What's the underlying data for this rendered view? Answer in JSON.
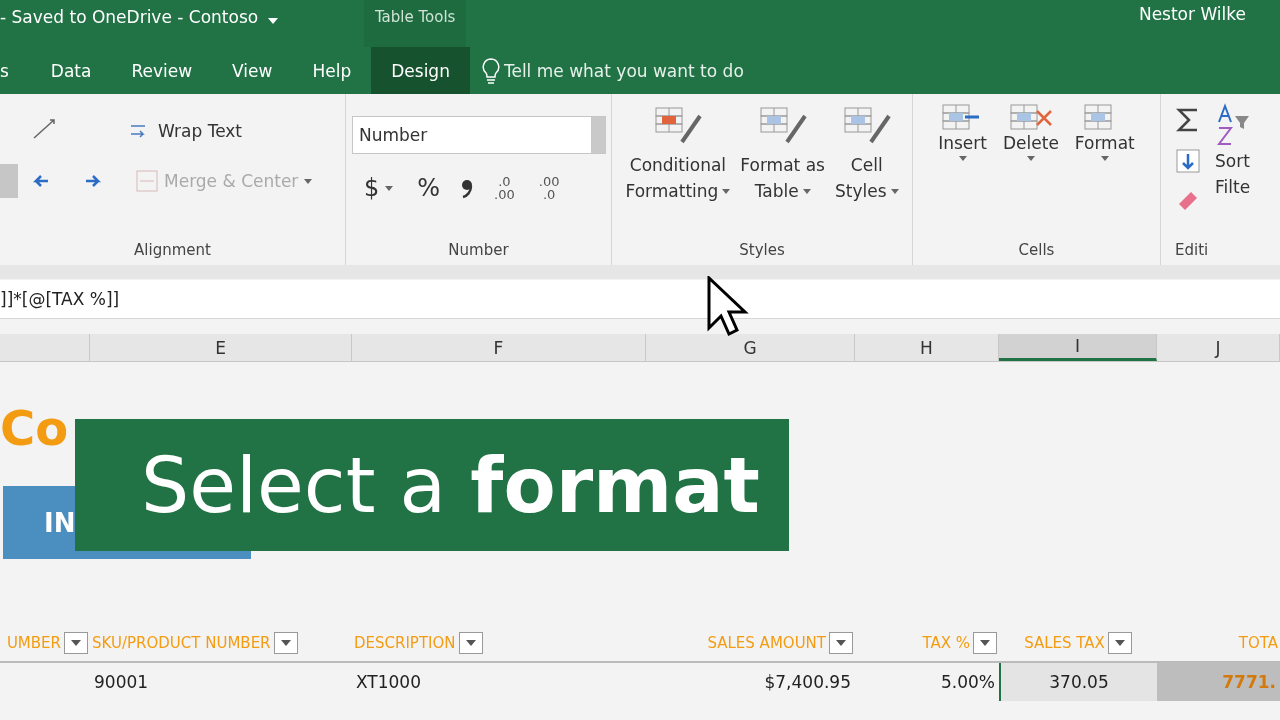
{
  "title_bar": {
    "title": "- Saved to OneDrive - Contoso",
    "context_label": "Table Tools",
    "user": "Nestor Wilke"
  },
  "tabs": [
    {
      "label": "s",
      "selected": false
    },
    {
      "label": "Data",
      "selected": false
    },
    {
      "label": "Review",
      "selected": false
    },
    {
      "label": "View",
      "selected": false
    },
    {
      "label": "Help",
      "selected": false
    },
    {
      "label": "Design",
      "selected": true
    }
  ],
  "tell_me": "Tell me what you want to do",
  "ribbon": {
    "alignment": {
      "wrap_text": "Wrap Text",
      "merge": "Merge & Center",
      "merge_disabled": true,
      "label": "Alignment"
    },
    "number": {
      "format": "Number",
      "currency": "$",
      "percent": "%",
      "decimals": [
        {
          "top": ".0",
          "bottom": ".00"
        },
        {
          "top": ".00",
          "bottom": ".0"
        }
      ],
      "label": "Number"
    },
    "styles": {
      "buttons": [
        {
          "line1": "Conditional",
          "line2": "Formatting"
        },
        {
          "line1": "Format as",
          "line2": "Table"
        },
        {
          "line1": "Cell",
          "line2": "Styles"
        }
      ],
      "label": "Styles"
    },
    "cells": {
      "buttons": [
        {
          "label": "Insert"
        },
        {
          "label": "Delete"
        },
        {
          "label": "Format"
        }
      ],
      "label": "Cells"
    },
    "editing": {
      "sort_line1": "Sort",
      "sort_line2": "Filte",
      "label": "Editi"
    }
  },
  "formula": "]]*[@[TAX %]]",
  "columns": [
    {
      "selected": false
    },
    {
      "label": "E",
      "selected": false
    },
    {
      "label": "F",
      "selected": false
    },
    {
      "label": "G",
      "selected": false
    },
    {
      "label": "H",
      "selected": false
    },
    {
      "label": "I",
      "selected": true
    },
    {
      "label": "J",
      "selected": false
    }
  ],
  "sheet": {
    "title": "Co",
    "banner": "IN"
  },
  "caption": "Select a **format**",
  "table": {
    "headers": [
      "UMBER",
      "SKU/PRODUCT NUMBER",
      "DESCRIPTION",
      "SALES AMOUNT",
      "TAX %",
      "SALES TAX",
      "TOTA"
    ],
    "rows": [
      [
        "",
        "90001",
        "XT1000",
        "$7,400.95",
        "5.00%",
        "370.05",
        "7771."
      ]
    ]
  }
}
